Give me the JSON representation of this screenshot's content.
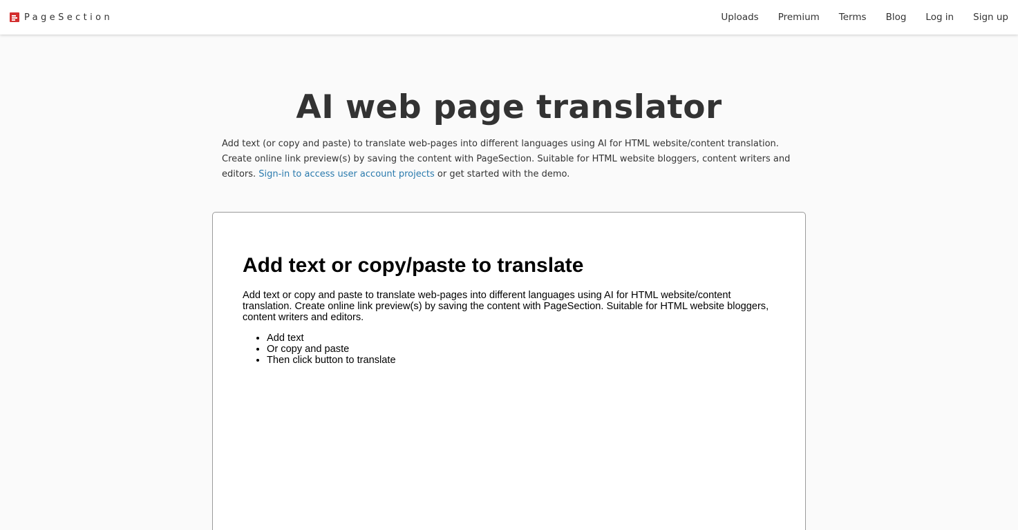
{
  "header": {
    "brand_name": "PageSection",
    "nav": [
      "Uploads",
      "Premium",
      "Terms",
      "Blog",
      "Log in",
      "Sign up"
    ]
  },
  "hero": {
    "title": "AI web page translator",
    "description": "Add text (or copy and paste) to translate web-pages into different languages using AI for HTML website/content translation. Create online link preview(s) by saving the content with PageSection. Suitable for HTML website bloggers, content writers and editors. ",
    "signin_link": "Sign-in to access user account projects",
    "description_end": " or get started with the demo."
  },
  "editor": {
    "heading": "Add text or copy/paste to translate",
    "paragraph": "Add text or copy and paste to translate web-pages into different languages using AI for HTML website/content translation. Create online link preview(s) by saving the content with PageSection. Suitable for HTML website bloggers, content writers and editors.",
    "list": [
      "Add text",
      "Or copy and paste",
      "Then click button to translate"
    ]
  },
  "colors": {
    "brand_red": "#d32f2f",
    "link_blue": "#2a7aad",
    "page_background": "#fafafa",
    "text": "#333333"
  },
  "icons": {
    "brand": "pagesection-logo-icon"
  }
}
